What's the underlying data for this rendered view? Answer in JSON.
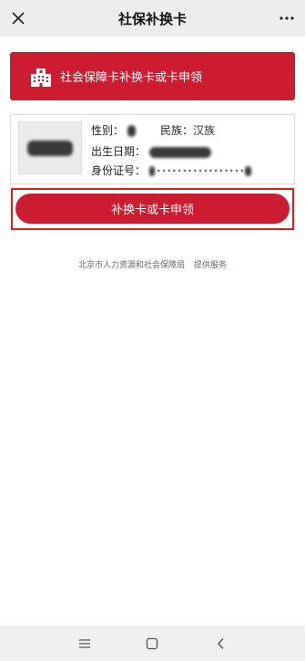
{
  "topbar": {
    "title": "社保补换卡",
    "close_icon": "close-icon",
    "more_icon": "more-dots-icon"
  },
  "banner": {
    "icon": "building-icon",
    "text": "社会保障卡补换卡或卡申领"
  },
  "person": {
    "gender_label": "性别：",
    "ethnicity_label": "民族：",
    "ethnicity_value": "汉族",
    "birth_label": "出生日期：",
    "id_label": "身份证号：",
    "id_value_masked": "•••••••••••••••••"
  },
  "action": {
    "button_label": "补换卡或卡申领"
  },
  "footer": {
    "provider": "北京市人力资源和社会保障局",
    "service": "提供服务"
  },
  "navbar": {
    "menu_icon": "menu-icon",
    "home_icon": "home-square-icon",
    "back_icon": "back-chevron-icon"
  },
  "colors": {
    "accent": "#cc1c2f",
    "highlight_border": "#e41b1b",
    "topbar_bg": "#ededed"
  }
}
